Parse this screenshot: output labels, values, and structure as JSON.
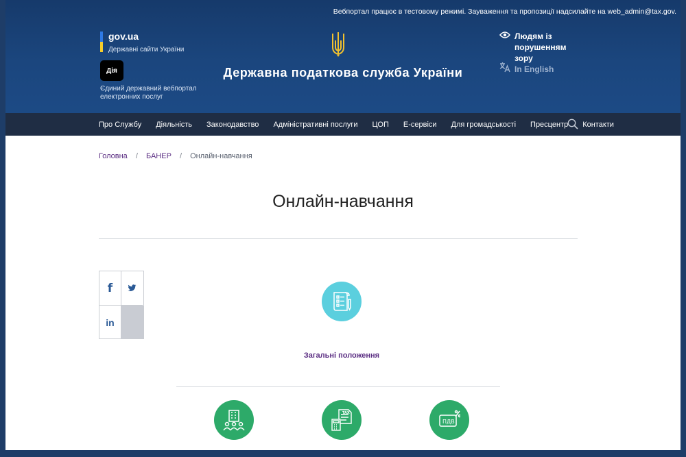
{
  "header": {
    "notice": "Вебпортал працює в тестовому режимі. Зауваження та пропозиції надсилайте на web_admin@tax.gov.",
    "govua_name": "gov.ua",
    "govua_sub": "Державні сайти України",
    "diia_badge": "Дія",
    "diia_text": "Єдиний державний вебпортал електронних послуг",
    "site_title": "Державна податкова служба України",
    "accessibility": "Людям із порушенням зору",
    "language": "In English"
  },
  "nav": {
    "items": [
      "Про Службу",
      "Діяльність",
      "Законодавство",
      "Адміністративні послуги",
      "ЦОП",
      "Е-сервіси",
      "Для громадськості",
      "Пресцентр",
      "Контакти"
    ]
  },
  "breadcrumbs": {
    "home": "Головна",
    "section": "БАНЕР",
    "current": "Онлайн-навчання",
    "separator": "/"
  },
  "page": {
    "title": "Онлайн-навчання"
  },
  "share": {
    "facebook": "f",
    "linkedin": "in"
  },
  "cards": {
    "first_label": "Загальні положення",
    "vat_badge": "ПДВ",
    "tax_badge": "TAX"
  },
  "colors": {
    "header_blue": "#1b467e",
    "nav_dark": "#1f2d44",
    "link_purple": "#5a2d82",
    "teal": "#5bcfde",
    "green": "#2daa69"
  },
  "icons": [
    "trident-icon",
    "eye-icon",
    "translate-icon",
    "search-icon",
    "facebook-icon",
    "twitter-icon",
    "linkedin-icon",
    "document-checklist-icon",
    "buildings-people-icon",
    "tax-calculator-icon",
    "vat-percent-icon"
  ]
}
